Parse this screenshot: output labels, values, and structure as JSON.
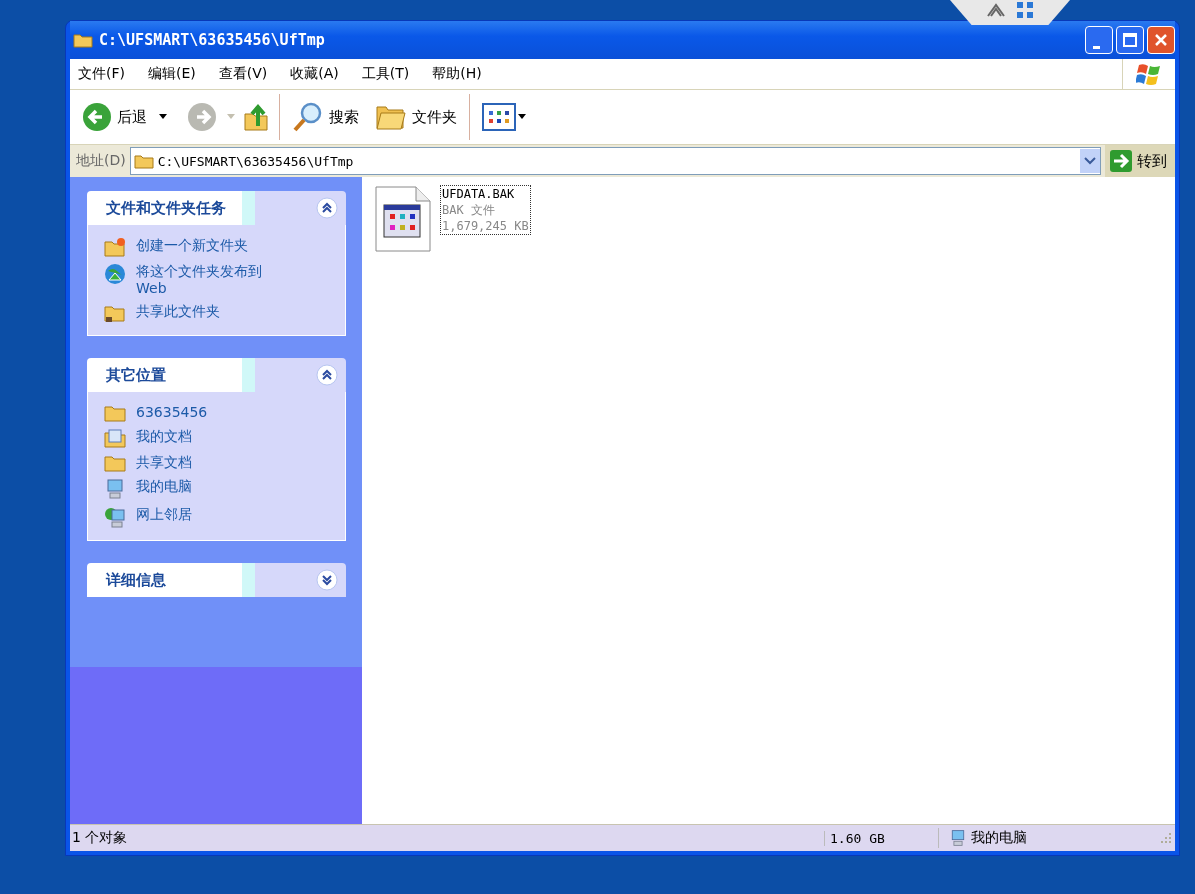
{
  "window": {
    "title": "C:\\UFSMART\\63635456\\UfTmp"
  },
  "menu": [
    "文件(F)",
    "编辑(E)",
    "查看(V)",
    "收藏(A)",
    "工具(T)",
    "帮助(H)"
  ],
  "toolbar": {
    "back": "后退",
    "search": "搜索",
    "folders": "文件夹"
  },
  "address": {
    "label": "地址(D)",
    "value": "C:\\UFSMART\\63635456\\UfTmp",
    "go": "转到"
  },
  "panels": [
    {
      "title": "文件和文件夹任务",
      "expanded": true,
      "items": [
        {
          "kind": "new-folder",
          "label": "创建一个新文件夹"
        },
        {
          "kind": "publish",
          "label": "将这个文件夹发布到 Web"
        },
        {
          "kind": "share",
          "label": "共享此文件夹"
        }
      ]
    },
    {
      "title": "其它位置",
      "expanded": true,
      "items": [
        {
          "kind": "folder",
          "label": "63635456"
        },
        {
          "kind": "documents",
          "label": "我的文档"
        },
        {
          "kind": "folder",
          "label": "共享文档"
        },
        {
          "kind": "computer",
          "label": "我的电脑"
        },
        {
          "kind": "network",
          "label": "网上邻居"
        }
      ]
    },
    {
      "title": "详细信息",
      "expanded": false
    }
  ],
  "files": [
    {
      "name": "UFDATA.BAK",
      "type": "BAK 文件",
      "size": "1,679,245 KB",
      "selected": true
    }
  ],
  "status_bar": {
    "objects": "1 个对象",
    "size": "1.60 GB",
    "location": "我的电脑"
  }
}
